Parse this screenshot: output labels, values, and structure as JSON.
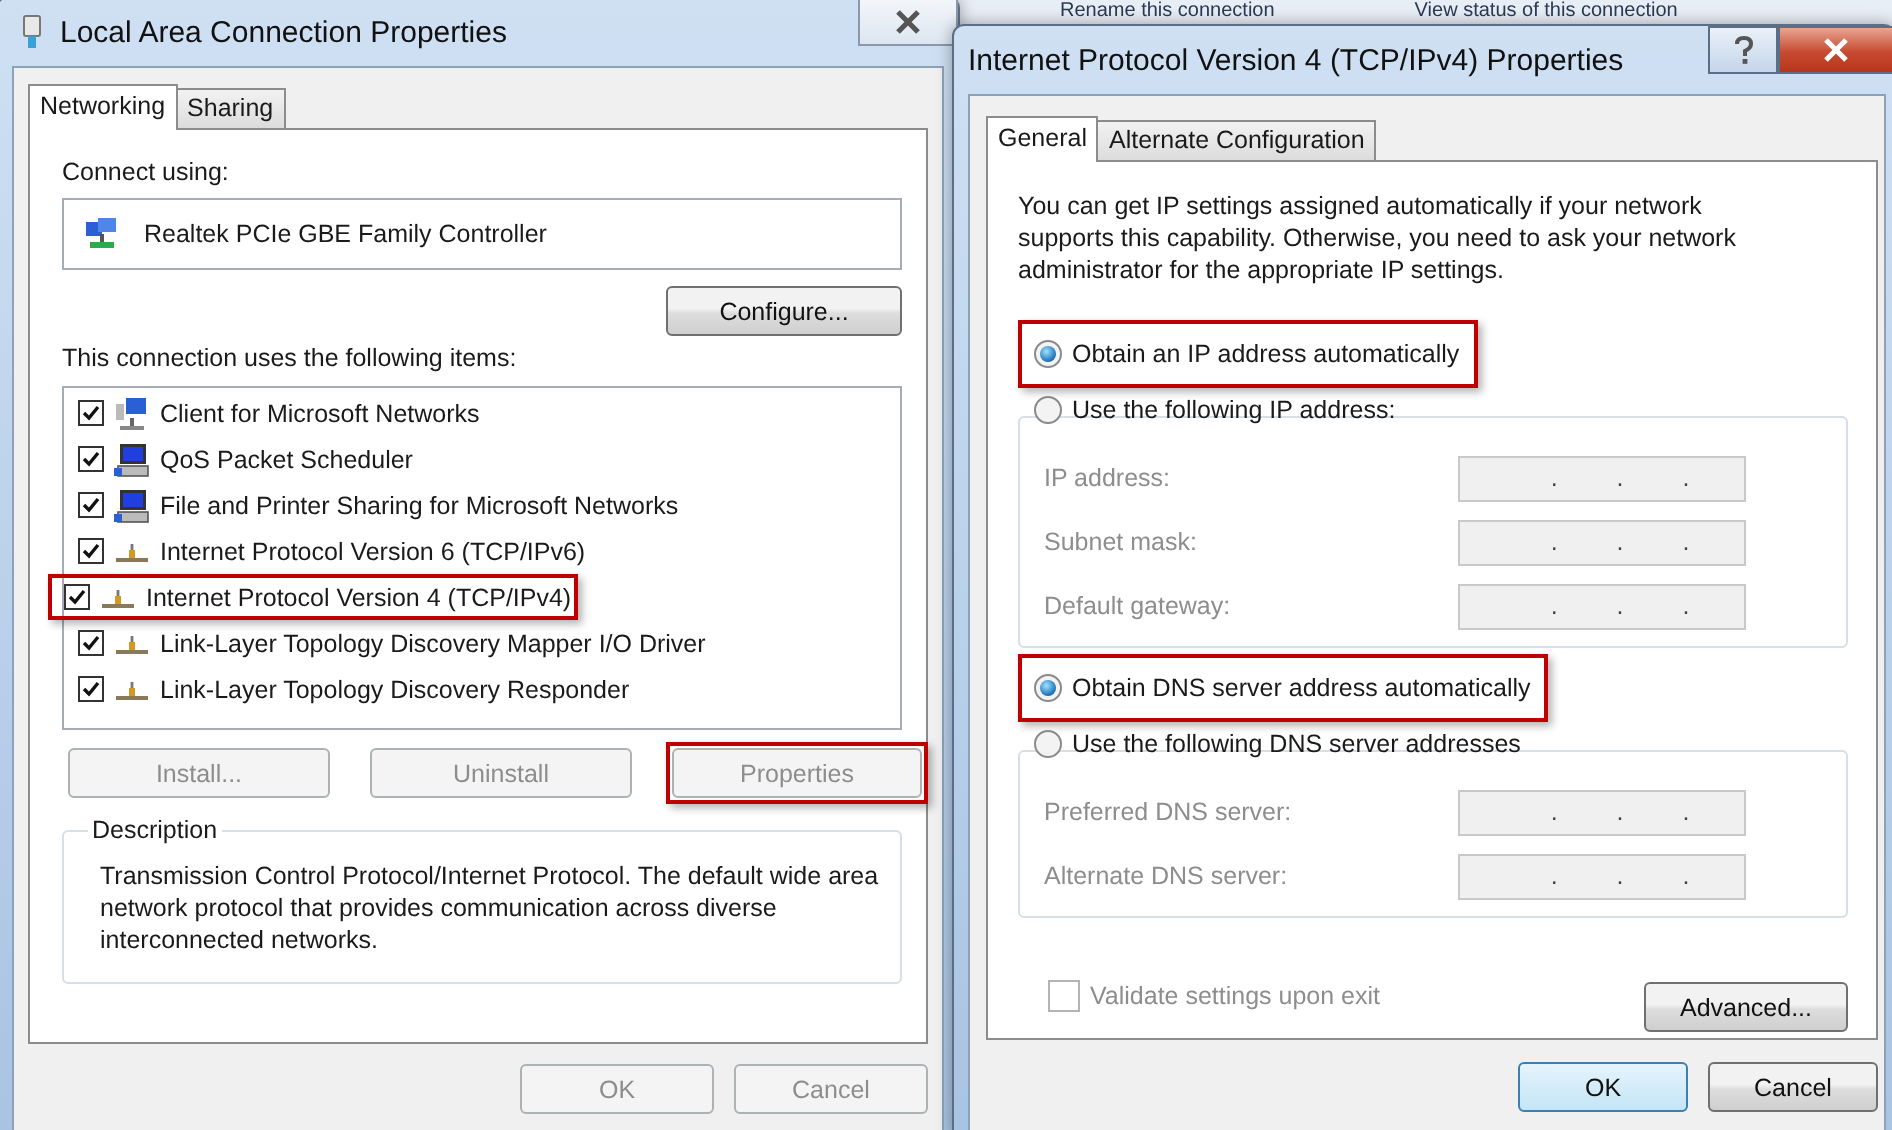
{
  "background": {
    "links": [
      "Rename this connection",
      "View status of this connection"
    ]
  },
  "lan": {
    "title": "Local Area Connection Properties",
    "tabs": [
      {
        "label": "Networking",
        "selected": true
      },
      {
        "label": "Sharing",
        "selected": false
      }
    ],
    "connect_using_label": "Connect using:",
    "adapter": "Realtek PCIe GBE Family Controller",
    "configure_button": "Configure...",
    "items_label": "This connection uses the following items:",
    "items": [
      {
        "label": "Client for Microsoft Networks",
        "checked": true,
        "kind": "client",
        "highlighted": false
      },
      {
        "label": "QoS Packet Scheduler",
        "checked": true,
        "kind": "service",
        "highlighted": false
      },
      {
        "label": "File and Printer Sharing for Microsoft Networks",
        "checked": true,
        "kind": "service",
        "highlighted": false
      },
      {
        "label": "Internet Protocol Version 6 (TCP/IPv6)",
        "checked": true,
        "kind": "protocol",
        "highlighted": false
      },
      {
        "label": "Internet Protocol Version 4 (TCP/IPv4)",
        "checked": true,
        "kind": "protocol",
        "highlighted": true
      },
      {
        "label": "Link-Layer Topology Discovery Mapper I/O Driver",
        "checked": true,
        "kind": "protocol",
        "highlighted": false
      },
      {
        "label": "Link-Layer Topology Discovery Responder",
        "checked": true,
        "kind": "protocol",
        "highlighted": false
      }
    ],
    "buttons": [
      {
        "label": "Install...",
        "disabled": true,
        "highlighted": false
      },
      {
        "label": "Uninstall",
        "disabled": true,
        "highlighted": false
      },
      {
        "label": "Properties",
        "disabled": true,
        "highlighted": true
      }
    ],
    "description": {
      "label": "Description",
      "text": "Transmission Control Protocol/Internet Protocol. The default wide area network protocol that provides communication across diverse interconnected networks."
    },
    "footer_buttons": [
      {
        "label": "OK",
        "disabled": true,
        "default": false
      },
      {
        "label": "Cancel",
        "disabled": true,
        "default": false
      }
    ]
  },
  "ipv4": {
    "title": "Internet Protocol Version 4 (TCP/IPv4) Properties",
    "tabs": [
      {
        "label": "General",
        "selected": true
      },
      {
        "label": "Alternate Configuration",
        "selected": false
      }
    ],
    "intro": "You can get IP settings assigned automatically if your network supports this capability. Otherwise, you need to ask your network administrator for the appropriate IP settings.",
    "sections": [
      {
        "options": [
          {
            "label": "Obtain an IP address automatically",
            "selected": true,
            "highlighted": true
          },
          {
            "label": "Use the following IP address:",
            "selected": false,
            "highlighted": false
          }
        ],
        "fields": [
          {
            "label": "IP address:",
            "value": ". . .",
            "disabled": true
          },
          {
            "label": "Subnet mask:",
            "value": ". . .",
            "disabled": true
          },
          {
            "label": "Default gateway:",
            "value": ". . .",
            "disabled": true
          }
        ]
      },
      {
        "options": [
          {
            "label": "Obtain DNS server address automatically",
            "selected": true,
            "highlighted": true
          },
          {
            "label": "Use the following DNS server addresses",
            "selected": false,
            "highlighted": false
          }
        ],
        "fields": [
          {
            "label": "Preferred DNS server:",
            "value": ". . .",
            "disabled": true
          },
          {
            "label": "Alternate DNS server:",
            "value": ". . .",
            "disabled": true
          }
        ]
      }
    ],
    "validate": {
      "label": "Validate settings upon exit",
      "checked": false,
      "disabled": true
    },
    "advanced_button": "Advanced...",
    "footer_buttons": [
      {
        "label": "OK",
        "disabled": false,
        "default": true
      },
      {
        "label": "Cancel",
        "disabled": false,
        "default": false
      }
    ]
  }
}
